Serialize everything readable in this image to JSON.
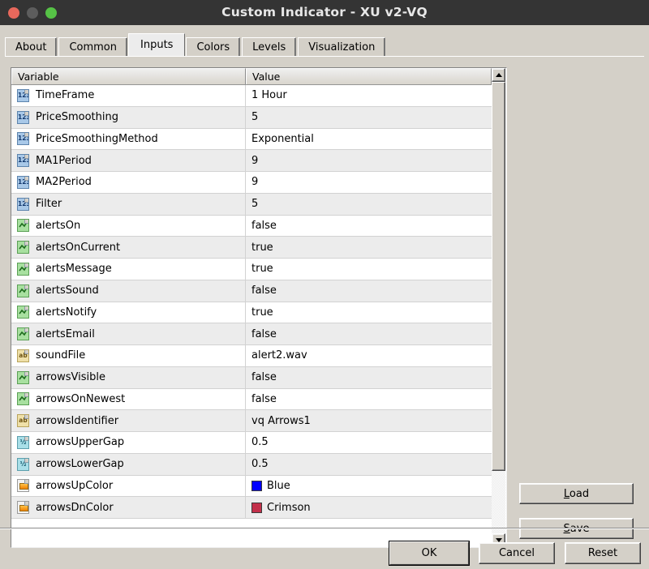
{
  "window": {
    "title": "Custom Indicator - XU v2-VQ",
    "traffic_lights": [
      {
        "name": "close",
        "color": "#e8685c"
      },
      {
        "name": "minimize",
        "color": "#5d5d5d"
      },
      {
        "name": "zoom",
        "color": "#56c246"
      }
    ]
  },
  "tabs": [
    {
      "label": "About",
      "active": false
    },
    {
      "label": "Common",
      "active": false
    },
    {
      "label": "Inputs",
      "active": true
    },
    {
      "label": "Colors",
      "active": false
    },
    {
      "label": "Levels",
      "active": false
    },
    {
      "label": "Visualization",
      "active": false
    }
  ],
  "table": {
    "columns": [
      "Variable",
      "Value"
    ],
    "rows": [
      {
        "icon": "int-type-icon",
        "name": "TimeFrame",
        "value": "1 Hour"
      },
      {
        "icon": "int-type-icon",
        "name": "PriceSmoothing",
        "value": "5"
      },
      {
        "icon": "int-type-icon",
        "name": "PriceSmoothingMethod",
        "value": "Exponential"
      },
      {
        "icon": "int-type-icon",
        "name": "MA1Period",
        "value": "9"
      },
      {
        "icon": "int-type-icon",
        "name": "MA2Period",
        "value": "9"
      },
      {
        "icon": "int-type-icon",
        "name": "Filter",
        "value": "5"
      },
      {
        "icon": "bool-type-icon",
        "name": "alertsOn",
        "value": "false"
      },
      {
        "icon": "bool-type-icon",
        "name": "alertsOnCurrent",
        "value": "true"
      },
      {
        "icon": "bool-type-icon",
        "name": "alertsMessage",
        "value": "true"
      },
      {
        "icon": "bool-type-icon",
        "name": "alertsSound",
        "value": "false"
      },
      {
        "icon": "bool-type-icon",
        "name": "alertsNotify",
        "value": "true"
      },
      {
        "icon": "bool-type-icon",
        "name": "alertsEmail",
        "value": "false"
      },
      {
        "icon": "string-type-icon",
        "name": "soundFile",
        "value": "alert2.wav"
      },
      {
        "icon": "bool-type-icon",
        "name": "arrowsVisible",
        "value": "false"
      },
      {
        "icon": "bool-type-icon",
        "name": "arrowsOnNewest",
        "value": "false"
      },
      {
        "icon": "string-type-icon",
        "name": "arrowsIdentifier",
        "value": "vq Arrows1"
      },
      {
        "icon": "double-type-icon",
        "name": "arrowsUpperGap",
        "value": "0.5"
      },
      {
        "icon": "double-type-icon",
        "name": "arrowsLowerGap",
        "value": "0.5"
      },
      {
        "icon": "color-type-icon",
        "name": "arrowsUpColor",
        "value": "Blue",
        "swatch": "#0000ff"
      },
      {
        "icon": "color-type-icon",
        "name": "arrowsDnColor",
        "value": "Crimson",
        "swatch": "#c3304a"
      }
    ]
  },
  "scrollbar": {
    "up_arrow": "scroll-up-icon",
    "down_arrow": "scroll-down-icon"
  },
  "side_buttons": {
    "load": {
      "accel": "L",
      "rest": "oad"
    },
    "save": {
      "accel": "S",
      "rest": "ave"
    }
  },
  "footer_buttons": {
    "ok": "OK",
    "cancel": "Cancel",
    "reset": "Reset"
  }
}
